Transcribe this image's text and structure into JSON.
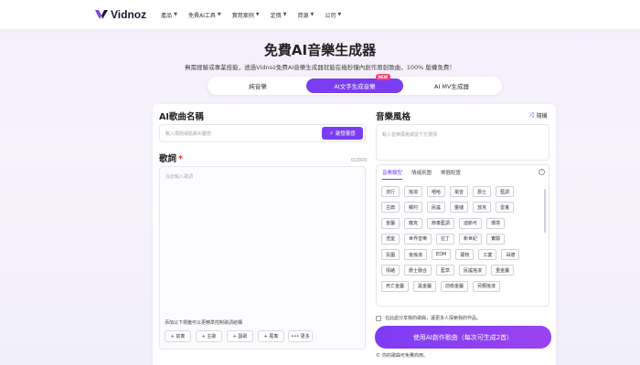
{
  "brand": {
    "name": "Vidnoz",
    "accent": "#7b3df1"
  },
  "nav": [
    {
      "label": "產品"
    },
    {
      "label": "免費AI工具"
    },
    {
      "label": "實用案例"
    },
    {
      "label": "定價"
    },
    {
      "label": "資源"
    },
    {
      "label": "公司"
    }
  ],
  "hero": {
    "title": "免費AI音樂生成器",
    "subtitle": "無需經驗或專業技能，透過Vidnoz免費AI音樂生成器就能在幾秒鐘內創作原創歌曲，100% 版權免費！"
  },
  "tabs": [
    {
      "label": "純音樂"
    },
    {
      "label": "AI文字生成音樂",
      "badge": "NEW"
    },
    {
      "label": "AI MV生成器"
    }
  ],
  "song": {
    "title": "AI歌曲名稱",
    "placeholder": "輸入標題或點擊AI靈感",
    "inspire": "激發靈感"
  },
  "lyrics": {
    "title": "歌詞",
    "required_mark": "*",
    "counter": "0/2000",
    "placeholder": "在此輸入歌詞",
    "hint": "添加以下標籤可以更精準控制歌詞結構",
    "chips": [
      "+ 前奏",
      "+ 主歌",
      "+ 副歌",
      "+ 尾奏",
      "••• 更多"
    ]
  },
  "style": {
    "title": "音樂風格",
    "shuffle": "隨機",
    "placeholder": "輸入音樂風格或從下方選擇",
    "tabs": [
      "音樂類型",
      "情緒氛圍",
      "樂器配置"
    ],
    "tags": [
      [
        "流行",
        "搖滾",
        "嘻哈",
        "電音",
        "爵士",
        "藍調"
      ],
      [
        "古典",
        "鄉村",
        "民謠",
        "靈魂",
        "放克",
        "雷鬼"
      ],
      [
        "金屬",
        "龐克",
        "節奏藍調",
        "迪斯可",
        "環境"
      ],
      [
        "浩室",
        "世界音樂",
        "拉丁",
        "新世紀",
        "實驗"
      ],
      [
        "氛圍",
        "後搖滾",
        "EDM",
        "硬核",
        "工業",
        "哥德"
      ],
      [
        "情緒",
        "爵士融合",
        "藍草",
        "民謠搖滾",
        "重金屬"
      ],
      [
        "死亡金屬",
        "黑金屬",
        "前衛金屬",
        "另類搖滾"
      ]
    ]
  },
  "consent": "在此處分享我的歌曲，讓更多人探索我的作品。",
  "generate": "使用AI創作歌曲（每次可生成2首）",
  "footnote": "你的歌曲可免費商用。"
}
